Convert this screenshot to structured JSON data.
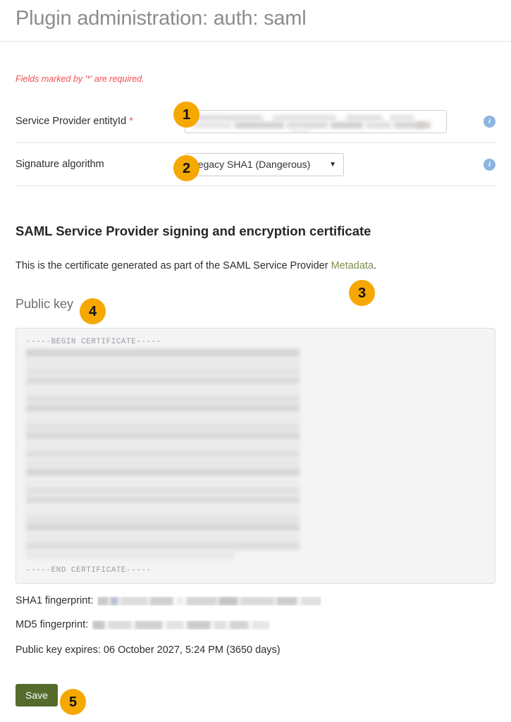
{
  "page": {
    "title": "Plugin administration: auth: saml"
  },
  "form": {
    "required_note": "Fields marked by '*' are required.",
    "rows": [
      {
        "label": "Service Provider entityId",
        "required_marker": "*",
        "control": "text-input",
        "info_icon": "info-icon"
      },
      {
        "label": "Signature algorithm",
        "required_marker": "",
        "control": "select",
        "selected_option": "Legacy SHA1 (Dangerous)",
        "caret": "▼",
        "info_icon": "info-icon"
      }
    ]
  },
  "certificate_section": {
    "heading": "SAML Service Provider signing and encryption certificate",
    "description_before_link": "This is the certificate generated as part of the SAML Service Provider ",
    "link_text": "Metadata",
    "description_after_link": ".",
    "public_key_label": "Public key",
    "cert_begin": "-----BEGIN CERTIFICATE-----",
    "cert_end": "-----END CERTIFICATE-----",
    "sha1_label": "SHA1 fingerprint:",
    "md5_label": "MD5 fingerprint:",
    "expires_text": "Public key expires: 06 October 2027, 5:24 PM (3650 days)"
  },
  "actions": {
    "save_label": "Save"
  },
  "callouts": [
    {
      "number": "1"
    },
    {
      "number": "2"
    },
    {
      "number": "3"
    },
    {
      "number": "4"
    },
    {
      "number": "5"
    }
  ],
  "colors": {
    "badge": "#f5a800",
    "save_button": "#556b2c",
    "link": "#7d8f4e",
    "required": "#ef4f4f",
    "info_icon": "#8cb4e0",
    "title": "#8a8d8f"
  }
}
